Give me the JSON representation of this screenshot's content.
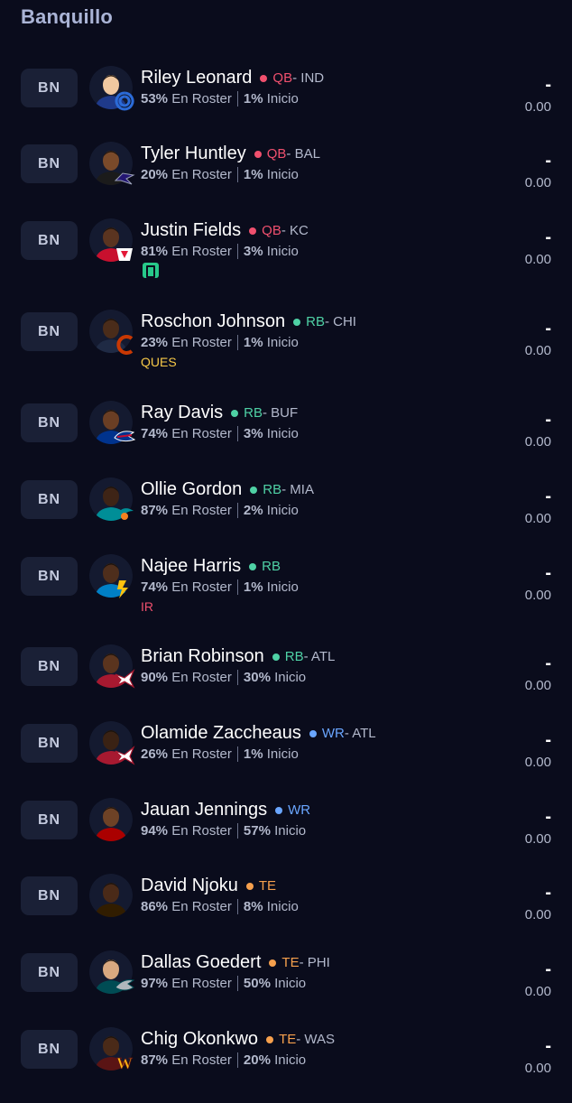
{
  "section_title": "Banquillo",
  "colors": {
    "QB": "#f0506e",
    "RB": "#4fd1a5",
    "WR": "#6aa6ff",
    "TE": "#f6a04d",
    "QUES": "#f7c948",
    "IR": "#f0506e"
  },
  "labels": {
    "roster": "En Roster",
    "start": "Inicio"
  },
  "players": [
    {
      "slot": "BN",
      "name": "Riley Leonard",
      "pos": "QB",
      "team": " - IND",
      "roster_pct": "53%",
      "start_pct": "1%",
      "status": "",
      "news": false,
      "projection": "-",
      "points": "0.00",
      "team_logo": "colts-logo-icon"
    },
    {
      "slot": "BN",
      "name": "Tyler Huntley",
      "pos": "QB",
      "team": " - BAL",
      "roster_pct": "20%",
      "start_pct": "1%",
      "status": "",
      "news": false,
      "projection": "-",
      "points": "0.00",
      "team_logo": "ravens-logo-icon"
    },
    {
      "slot": "BN",
      "name": "Justin Fields",
      "pos": "QB",
      "team": " - KC",
      "roster_pct": "81%",
      "start_pct": "3%",
      "status": "",
      "news": true,
      "projection": "-",
      "points": "0.00",
      "team_logo": "chiefs-logo-icon"
    },
    {
      "slot": "BN",
      "name": "Roschon Johnson",
      "pos": "RB",
      "team": " - CHI",
      "roster_pct": "23%",
      "start_pct": "1%",
      "status": "QUES",
      "news": false,
      "projection": "-",
      "points": "0.00",
      "team_logo": "bears-logo-icon"
    },
    {
      "slot": "BN",
      "name": "Ray Davis",
      "pos": "RB",
      "team": " - BUF",
      "roster_pct": "74%",
      "start_pct": "3%",
      "status": "",
      "news": false,
      "projection": "-",
      "points": "0.00",
      "team_logo": "bills-logo-icon"
    },
    {
      "slot": "BN",
      "name": "Ollie Gordon",
      "pos": "RB",
      "team": " - MIA",
      "roster_pct": "87%",
      "start_pct": "2%",
      "status": "",
      "news": false,
      "projection": "-",
      "points": "0.00",
      "team_logo": "dolphins-logo-icon"
    },
    {
      "slot": "BN",
      "name": "Najee Harris",
      "pos": "RB",
      "team": "",
      "roster_pct": "74%",
      "start_pct": "1%",
      "status": "IR",
      "news": false,
      "projection": "-",
      "points": "0.00",
      "team_logo": "chargers-logo-icon"
    },
    {
      "slot": "BN",
      "name": "Brian Robinson",
      "pos": "RB",
      "team": " - ATL",
      "roster_pct": "90%",
      "start_pct": "30%",
      "status": "",
      "news": false,
      "projection": "-",
      "points": "0.00",
      "team_logo": "falcons-logo-icon"
    },
    {
      "slot": "BN",
      "name": "Olamide Zaccheaus",
      "pos": "WR",
      "team": " - ATL",
      "roster_pct": "26%",
      "start_pct": "1%",
      "status": "",
      "news": false,
      "projection": "-",
      "points": "0.00",
      "team_logo": "falcons-logo-icon"
    },
    {
      "slot": "BN",
      "name": "Jauan Jennings",
      "pos": "WR",
      "team": "",
      "roster_pct": "94%",
      "start_pct": "57%",
      "status": "",
      "news": false,
      "projection": "-",
      "points": "0.00",
      "team_logo": ""
    },
    {
      "slot": "BN",
      "name": "David Njoku",
      "pos": "TE",
      "team": "",
      "roster_pct": "86%",
      "start_pct": "8%",
      "status": "",
      "news": false,
      "projection": "-",
      "points": "0.00",
      "team_logo": ""
    },
    {
      "slot": "BN",
      "name": "Dallas Goedert",
      "pos": "TE",
      "team": " - PHI",
      "roster_pct": "97%",
      "start_pct": "50%",
      "status": "",
      "news": false,
      "projection": "-",
      "points": "0.00",
      "team_logo": "eagles-logo-icon"
    },
    {
      "slot": "BN",
      "name": "Chig Okonkwo",
      "pos": "TE",
      "team": " - WAS",
      "roster_pct": "87%",
      "start_pct": "20%",
      "status": "",
      "news": false,
      "projection": "-",
      "points": "0.00",
      "team_logo": "commanders-logo-icon"
    }
  ]
}
